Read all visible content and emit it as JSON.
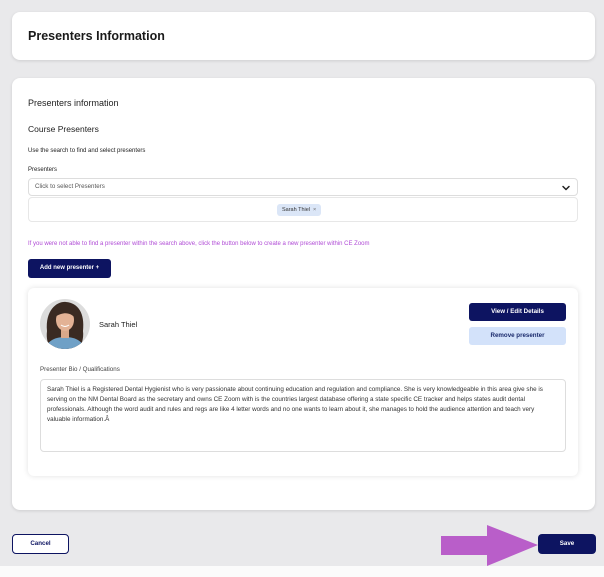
{
  "header": {
    "title": "Presenters Information"
  },
  "section": {
    "title": "Presenters information",
    "subtitle": "Course Presenters",
    "help_text": "Use the search to find and select presenters"
  },
  "presenters_field": {
    "label": "Presenters",
    "placeholder": "Click to select Presenters",
    "selected": [
      {
        "name": "Sarah Thiel",
        "remove": "×"
      }
    ]
  },
  "create_hint": "If you were not able to find a presenter within the search above, click the button below to create a new presenter within CE Zoom",
  "add_button": "Add new presenter +",
  "presenter": {
    "name": "Sarah Thiel",
    "view_button": "View / Edit Details",
    "remove_button": "Remove presenter",
    "bio_label": "Presenter Bio / Qualifications",
    "bio": "Sarah Thiel is a Registered Dental Hygienist who is very passionate about continuing education and regulation and compliance. She is very knowledgeable in this area give she is serving on the NM Dental Board as the secretary and owns CE Zoom with is the countries largest database offering a state specific CE tracker and helps states audit dental professionals. Although the word audit and rules and regs are like 4 letter words and no one wants to learn about it, she manages to hold the audience attention and teach very valuable information.Â"
  },
  "footer": {
    "cancel": "Cancel",
    "save": "Save"
  },
  "icons": {
    "dropdown": "chevron-down-icon",
    "arrow": "arrow-right-icon"
  },
  "colors": {
    "primary": "#0d1461",
    "secondary": "#d3e2fa",
    "hint": "#b04bd6",
    "annotation_arrow": "#b95ec9"
  }
}
